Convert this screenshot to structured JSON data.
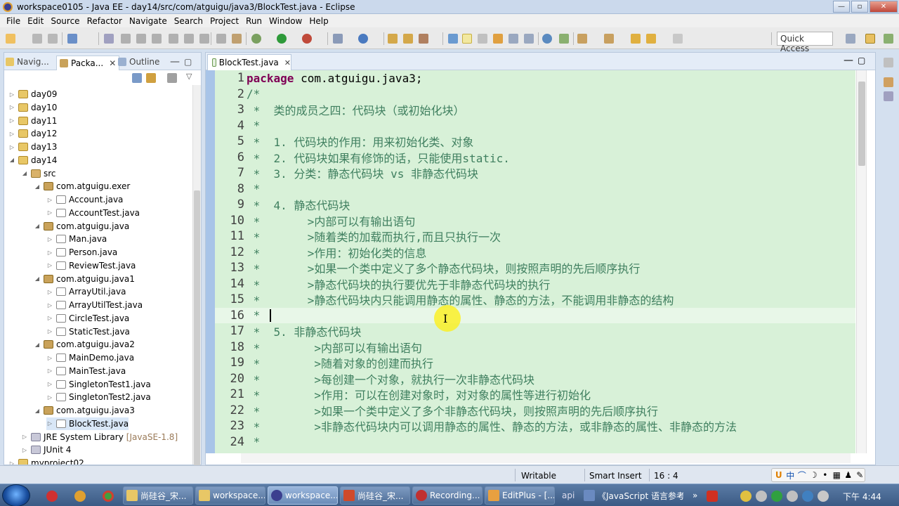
{
  "window": {
    "title": "workspace0105 - Java EE - day14/src/com/atguigu/java3/BlockTest.java - Eclipse"
  },
  "menu": [
    "File",
    "Edit",
    "Source",
    "Refactor",
    "Navigate",
    "Search",
    "Project",
    "Run",
    "Window",
    "Help"
  ],
  "toolbar": {
    "quick_access": "Quick Access"
  },
  "left_panel": {
    "tabs": [
      "Navig...",
      "Packa...",
      "Outline"
    ],
    "tree": [
      {
        "label": "day09",
        "type": "project",
        "expanded": false,
        "indent": 0
      },
      {
        "label": "day10",
        "type": "project",
        "expanded": false,
        "indent": 0
      },
      {
        "label": "day11",
        "type": "project",
        "expanded": false,
        "indent": 0
      },
      {
        "label": "day12",
        "type": "project",
        "expanded": false,
        "indent": 0
      },
      {
        "label": "day13",
        "type": "project",
        "expanded": false,
        "indent": 0
      },
      {
        "label": "day14",
        "type": "project",
        "expanded": true,
        "indent": 0
      },
      {
        "label": "src",
        "type": "src",
        "expanded": true,
        "indent": 1
      },
      {
        "label": "com.atguigu.exer",
        "type": "package",
        "expanded": true,
        "indent": 2
      },
      {
        "label": "Account.java",
        "type": "java",
        "expanded": false,
        "indent": 3
      },
      {
        "label": "AccountTest.java",
        "type": "java",
        "expanded": false,
        "indent": 3
      },
      {
        "label": "com.atguigu.java",
        "type": "package",
        "expanded": true,
        "indent": 2
      },
      {
        "label": "Man.java",
        "type": "java",
        "expanded": false,
        "indent": 3
      },
      {
        "label": "Person.java",
        "type": "java",
        "expanded": false,
        "indent": 3
      },
      {
        "label": "ReviewTest.java",
        "type": "java",
        "expanded": false,
        "indent": 3
      },
      {
        "label": "com.atguigu.java1",
        "type": "package",
        "expanded": true,
        "indent": 2
      },
      {
        "label": "ArrayUtil.java",
        "type": "java",
        "expanded": false,
        "indent": 3
      },
      {
        "label": "ArrayUtilTest.java",
        "type": "java",
        "expanded": false,
        "indent": 3
      },
      {
        "label": "CircleTest.java",
        "type": "java",
        "expanded": false,
        "indent": 3
      },
      {
        "label": "StaticTest.java",
        "type": "java",
        "expanded": false,
        "indent": 3
      },
      {
        "label": "com.atguigu.java2",
        "type": "package",
        "expanded": true,
        "indent": 2
      },
      {
        "label": "MainDemo.java",
        "type": "java",
        "expanded": false,
        "indent": 3
      },
      {
        "label": "MainTest.java",
        "type": "java",
        "expanded": false,
        "indent": 3
      },
      {
        "label": "SingletonTest1.java",
        "type": "java",
        "expanded": false,
        "indent": 3
      },
      {
        "label": "SingletonTest2.java",
        "type": "java",
        "expanded": false,
        "indent": 3
      },
      {
        "label": "com.atguigu.java3",
        "type": "package",
        "expanded": true,
        "indent": 2
      },
      {
        "label": "BlockTest.java",
        "type": "java",
        "expanded": false,
        "indent": 3,
        "selected": true
      },
      {
        "label": "JRE System Library",
        "type": "lib",
        "expanded": false,
        "indent": 1,
        "suffix": "[JavaSE-1.8]"
      },
      {
        "label": "JUnit 4",
        "type": "lib",
        "expanded": false,
        "indent": 1
      },
      {
        "label": "myproject02",
        "type": "project",
        "expanded": false,
        "indent": 0
      }
    ]
  },
  "editor": {
    "tab": "BlockTest.java",
    "lines": [
      {
        "n": "1",
        "kw": "package",
        "text": " com.atguigu.java3;"
      },
      {
        "n": "2",
        "text": "/*"
      },
      {
        "n": "3",
        "text": " *  类的成员之四：代码块（或初始化块）"
      },
      {
        "n": "4",
        "text": " *"
      },
      {
        "n": "5",
        "text": " *  1. 代码块的作用：用来初始化类、对象"
      },
      {
        "n": "6",
        "text": " *  2. 代码块如果有修饰的话，只能使用static."
      },
      {
        "n": "7",
        "text": " *  3. 分类：静态代码块 vs 非静态代码块"
      },
      {
        "n": "8",
        "text": " *"
      },
      {
        "n": "9",
        "text": " *  4. 静态代码块"
      },
      {
        "n": "10",
        "text": " *       >内部可以有输出语句"
      },
      {
        "n": "11",
        "text": " *       >随着类的加载而执行,而且只执行一次"
      },
      {
        "n": "12",
        "text": " *       >作用：初始化类的信息"
      },
      {
        "n": "13",
        "text": " *       >如果一个类中定义了多个静态代码块，则按照声明的先后顺序执行"
      },
      {
        "n": "14",
        "text": " *       >静态代码块的执行要优先于非静态代码块的执行"
      },
      {
        "n": "15",
        "text": " *       >静态代码块内只能调用静态的属性、静态的方法，不能调用非静态的结构"
      },
      {
        "n": "16",
        "text": " * ",
        "current": true
      },
      {
        "n": "17",
        "text": " *  5. 非静态代码块"
      },
      {
        "n": "18",
        "text": " *        >内部可以有输出语句"
      },
      {
        "n": "19",
        "text": " *        >随着对象的创建而执行"
      },
      {
        "n": "20",
        "text": " *        >每创建一个对象，就执行一次非静态代码块"
      },
      {
        "n": "21",
        "text": " *        >作用：可以在创建对象时，对对象的属性等进行初始化"
      },
      {
        "n": "22",
        "text": " *        >如果一个类中定义了多个非静态代码块，则按照声明的先后顺序执行"
      },
      {
        "n": "23",
        "text": " *        >非静态代码块内可以调用静态的属性、静态的方法，或非静态的属性、非静态的方法"
      },
      {
        "n": "24",
        "text": " *"
      }
    ]
  },
  "status": {
    "writable": "Writable",
    "insert_mode": "Smart Insert",
    "position": "16 : 4",
    "ime": [
      "中",
      "⌒"
    ]
  },
  "taskbar": {
    "items": [
      "尚硅谷_宋...",
      "workspace...",
      "workspace...",
      "尚硅谷_宋...",
      "Recording...",
      "EditPlus - [...",
      "api",
      "《JavaScript 语言参考..."
    ],
    "clock": "下午 4:44"
  },
  "colors": {
    "comment": "#3f7f5f",
    "keyword": "#7f0055",
    "code_bg": "#d8f1d8",
    "gutter": "#a8c4e8"
  }
}
